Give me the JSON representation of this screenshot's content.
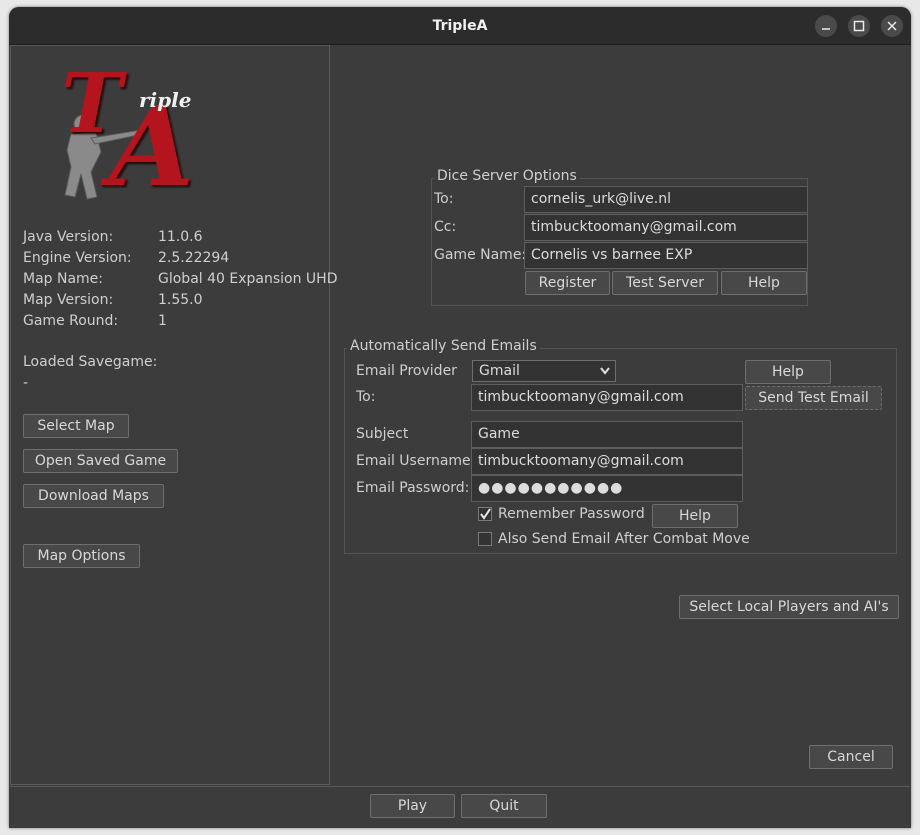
{
  "window": {
    "title": "TripleA"
  },
  "titlebar": {
    "minimize_icon": "minimize-icon",
    "maximize_icon": "maximize-icon",
    "close_icon": "close-icon"
  },
  "logo": {
    "text_big": "A",
    "text_t": "T",
    "text_small": "riple"
  },
  "info": {
    "java_version_label": "Java Version:",
    "java_version": "11.0.6",
    "engine_version_label": "Engine Version:",
    "engine_version": "2.5.22294",
    "map_name_label": "Map Name:",
    "map_name": "Global 40 Expansion UHD",
    "map_version_label": "Map Version:",
    "map_version": "1.55.0",
    "game_round_label": "Game Round:",
    "game_round": "1",
    "loaded_savegame_label": "Loaded Savegame:",
    "loaded_savegame": "-"
  },
  "left_buttons": {
    "select_map": "Select Map",
    "open_saved_game": "Open Saved Game",
    "download_maps": "Download Maps",
    "map_options": "Map Options"
  },
  "dice": {
    "legend": "Dice Server Options",
    "to_label": "To:",
    "to_value": "cornelis_urk@live.nl",
    "cc_label": "Cc:",
    "cc_value": "timbucktoomany@gmail.com",
    "game_name_label": "Game Name:",
    "game_name_value": "Cornelis vs barnee EXP",
    "register": "Register",
    "test_server": "Test Server",
    "help": "Help"
  },
  "email": {
    "legend": "Automatically Send Emails",
    "provider_label": "Email Provider",
    "provider_value": "Gmail",
    "help": "Help",
    "to_label": "To:",
    "to_value": "timbucktoomany@gmail.com",
    "send_test": "Send Test Email",
    "subject_label": "Subject",
    "subject_value": "Game",
    "username_label": "Email Username:",
    "username_value": "timbucktoomany@gmail.com",
    "password_label": "Email Password:",
    "password_value": "●●●●●●●●●●●",
    "remember_label": "Remember Password",
    "remember_checked": true,
    "remember_help": "Help",
    "combat_label": "Also Send Email After Combat Move",
    "combat_checked": false
  },
  "actions": {
    "select_players": "Select Local Players and AI's",
    "cancel": "Cancel",
    "play": "Play",
    "quit": "Quit"
  }
}
